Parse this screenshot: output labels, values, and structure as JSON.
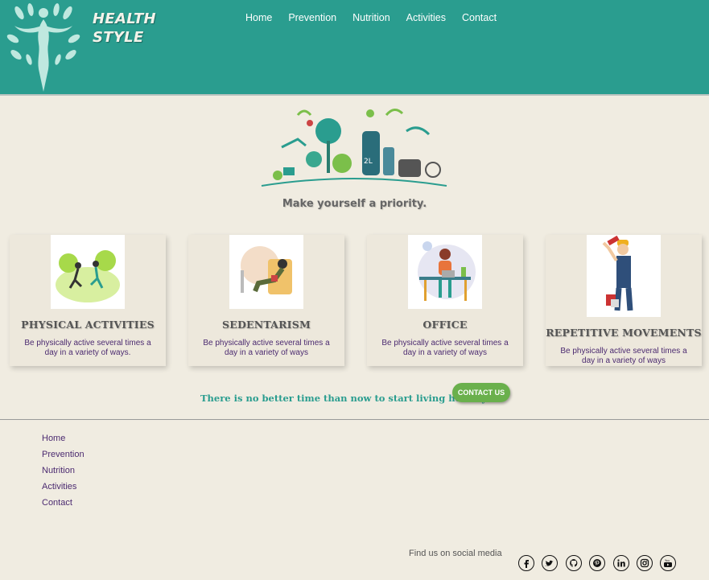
{
  "brand": {
    "line1": "HEALTH",
    "line2": "STYLE"
  },
  "nav": {
    "items": [
      "Home",
      "Prevention",
      "Nutrition",
      "Activities",
      "Contact"
    ]
  },
  "hero": {
    "tagline": "Make yourself a priority."
  },
  "cards": [
    {
      "title": "PHYSICAL ACTIVITIES",
      "text": "Be physically active several times a day in a variety of ways."
    },
    {
      "title": "SEDENTARISM",
      "text": "Be physically active several times a day in a variety of ways"
    },
    {
      "title": "OFFICE",
      "text": "Be physically active several times a day in a variety of ways"
    },
    {
      "title": "REPETITIVE MOVEMENTS",
      "text": "Be physically active several times a day in a variety of ways"
    }
  ],
  "cta": {
    "text": "There is no better time than now to start living healthy.",
    "button": "CONTACT US"
  },
  "footer": {
    "links": [
      "Home",
      "Prevention",
      "Nutrition",
      "Activities",
      "Contact"
    ],
    "social_label": "Find us on social media",
    "social_icons": [
      "facebook-icon",
      "twitter-icon",
      "github-icon",
      "pinterest-icon",
      "linkedin-icon",
      "instagram-icon",
      "youtube-icon"
    ]
  },
  "colors": {
    "header": "#2a9d8f",
    "background": "#f0ece1",
    "accent_green": "#6ab04c",
    "link_purple": "#4b2a70"
  }
}
